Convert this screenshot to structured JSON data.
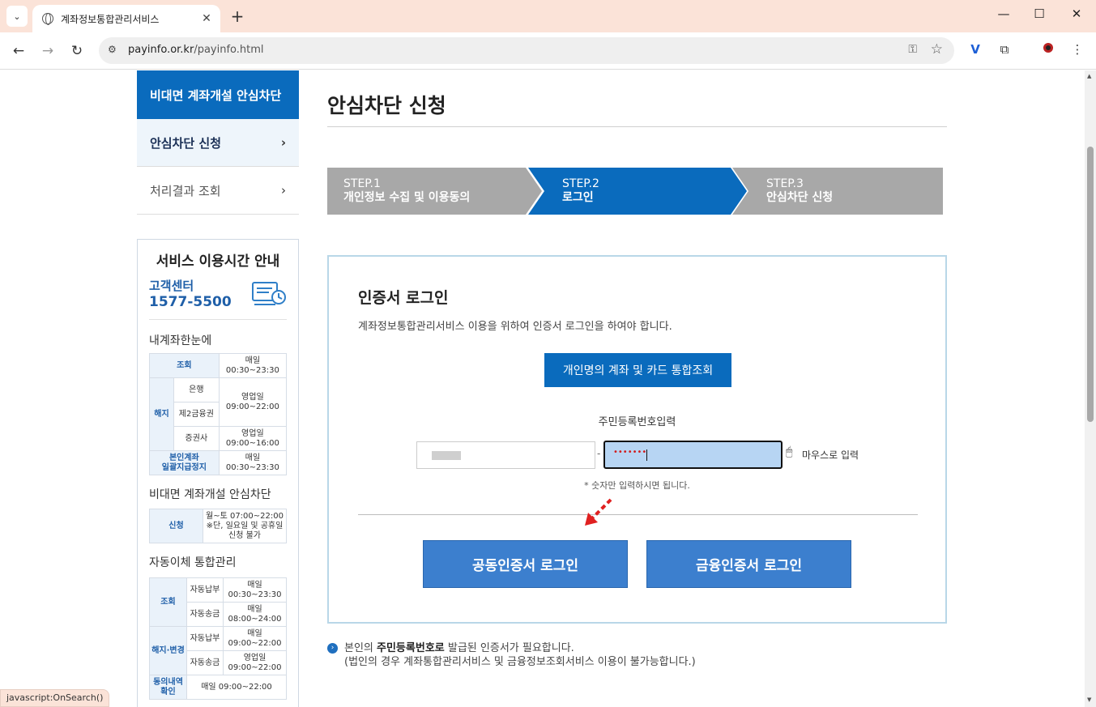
{
  "browser": {
    "tab_title": "계좌정보통합관리서비스",
    "url_domain": "payinfo.or.kr",
    "url_path": "/payinfo.html",
    "status_text": "javascript:OnSearch()"
  },
  "sidebar": {
    "heading": "비대면 계좌개설 안심차단",
    "items": [
      {
        "label": "안심차단 신청"
      },
      {
        "label": "처리결과 조회"
      }
    ]
  },
  "hours": {
    "title": "서비스 이용시간 안내",
    "cc_label": "고객센터",
    "cc_phone": "1577-5500",
    "s1_title": "내계좌한눈에",
    "s1": {
      "r1": {
        "cat": "조회",
        "time": "매일\n00:30~23:30"
      },
      "cat_close": "해지",
      "bank": "은행",
      "fin2": "제2금융권",
      "biz1": "영업일\n09:00~22:00",
      "sec": "증권사",
      "biz2": "영업일\n09:00~16:00",
      "r4cat": "본인계좌\n일괄지급정지",
      "r4time": "매일\n00:30~23:30"
    },
    "s2_title": "비대면 계좌개설 안심차단",
    "s2": {
      "cat": "신청",
      "time": "월~토 07:00~22:00",
      "note": "※단, 일요일 및 공휴일\n신청 불가"
    },
    "s3_title": "자동이체 통합관리",
    "s3": {
      "cat1": "조회",
      "pay": "자동납부",
      "pay_time": "매일\n00:30~23:30",
      "send": "자동송금",
      "send_time": "매일\n08:00~24:00",
      "cat2": "해지·변경",
      "pay2_time": "매일\n09:00~22:00",
      "send2_time": "영업일\n09:00~22:00",
      "cat3": "동의내역\n확인",
      "cat3_time": "매일 09:00~22:00"
    }
  },
  "main": {
    "title": "안심차단 신청",
    "steps": [
      {
        "step": "STEP.1",
        "text": "개인정보 수집 및 이용동의",
        "active": false
      },
      {
        "step": "STEP.2",
        "text": "로그인",
        "active": true
      },
      {
        "step": "STEP.3",
        "text": "안심차단 신청",
        "active": false
      }
    ],
    "login": {
      "title": "인증서 로그인",
      "desc": "계좌정보통합관리서비스 이용을 위하여 인증서 로그인을 하여야 합니다.",
      "lookup_button": "개인명의 계좌 및 카드 통합조회",
      "rrn_label": "주민등록번호입력",
      "rrn_back_masked": "•••••••",
      "dash": "-",
      "mouse_input": "마우스로 입력",
      "hint": "* 숫자만 입력하시면 됩니다.",
      "joint_cert_button": "공동인증서 로그인",
      "fin_cert_button": "금융인증서 로그인"
    },
    "notice_pre": "본인의 ",
    "notice_bold": "주민등록번호로",
    "notice_post": " 발급된 인증서가 필요합니다.",
    "notice_line2": "(법인의 경우 계좌통합관리서비스 및 금융정보조회서비스 이용이 불가능합니다.)"
  },
  "colors": {
    "brand_blue": "#0a6bbd",
    "cert_button": "#3c7fce",
    "step_inactive": "#a8a8a8",
    "tab_bar": "#fbe3d8"
  }
}
